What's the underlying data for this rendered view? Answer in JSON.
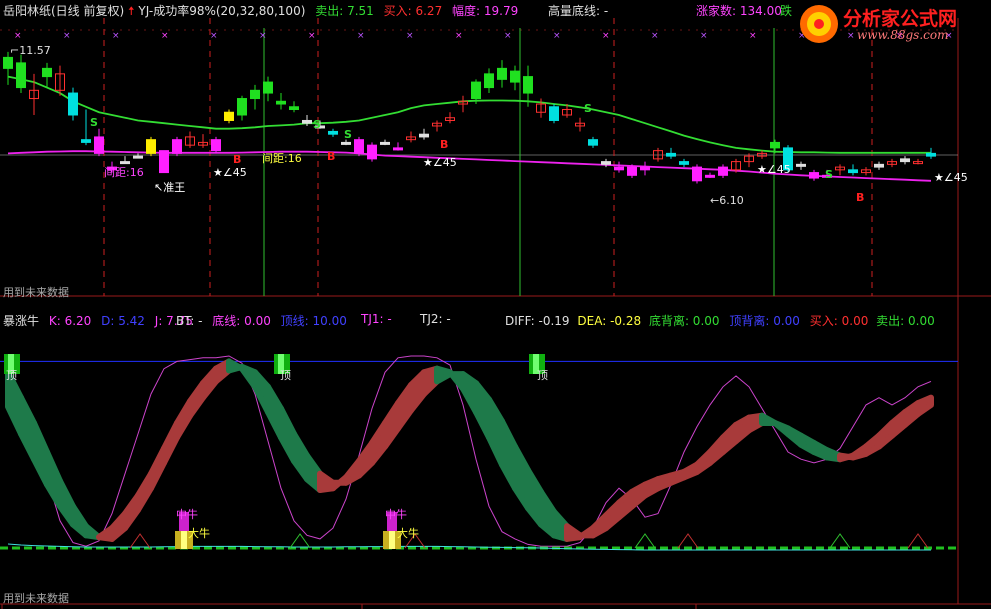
{
  "header_top": {
    "stock_name": "岳阳林纸(日线 前复权)",
    "indicator": "YJ-成功率98%(20,32,80,100)",
    "sell_label": "卖出: 7.51",
    "buy_label": "买入: 6.27",
    "range_label": "幅度: 19.79",
    "volume_line": "高量底线: -",
    "home_label": "涨家数: 134.00",
    "trailing": "跌"
  },
  "logo": {
    "brand": "分析家公式网",
    "site": "www.88gs.com"
  },
  "header_bottom": {
    "name": "暴涨牛",
    "k": "K: 6.20",
    "d": "D: 5.42",
    "j": "J: 7.75",
    "bt": "BT: -",
    "bottom_line": "底线: 0.00",
    "top_line": "顶线: 10.00",
    "tj1": "TJ1: -",
    "tj2": "TJ2: -",
    "diff": "DIFF: -0.19",
    "dea": "DEA: -0.28",
    "bottom_div": "底背离: 0.00",
    "top_div": "顶背离: 0.00",
    "buy": "买入: 0.00",
    "sell": "卖出: 0.00"
  },
  "annotations": {
    "high_price": "11.57",
    "low_price": "6.10",
    "future_data_top": "用到未来数据",
    "future_data_bottom": "用到未来数据",
    "distance": "间距:16",
    "king": "准王",
    "angle": "∠45",
    "buy_mark": "B",
    "sell_mark": "S",
    "top_mark": "顶",
    "mid_bull": "中牛",
    "big_bull": "大牛"
  },
  "colors": {
    "up": "#ff3030",
    "down": "#00e0e0",
    "green_bar": "#20e020",
    "magenta_bar": "#ff20ff",
    "ma_green": "#33dd33",
    "ma_magenta": "#ee22ee",
    "kdj_k_up": "#a83a3a",
    "kdj_k_down": "#1e7a4a",
    "dline": "#cc44cc"
  },
  "chart_data": [
    {
      "type": "candlestick",
      "title": "岳阳林纸(日线 前复权)",
      "price_annotations": {
        "high": 11.57,
        "low": 6.1
      },
      "candles": [
        {
          "o": 10.9,
          "h": 11.5,
          "l": 10.3,
          "c": 11.3,
          "k": "g"
        },
        {
          "o": 10.2,
          "h": 11.4,
          "l": 10.0,
          "c": 11.1,
          "k": "g"
        },
        {
          "o": 9.8,
          "h": 10.7,
          "l": 9.2,
          "c": 10.1,
          "k": "r"
        },
        {
          "o": 10.6,
          "h": 11.1,
          "l": 10.2,
          "c": 10.9,
          "k": "g"
        },
        {
          "o": 10.7,
          "h": 11.0,
          "l": 9.9,
          "c": 10.1,
          "k": "r"
        },
        {
          "o": 10.0,
          "h": 10.2,
          "l": 9.0,
          "c": 9.2,
          "k": "c"
        },
        {
          "o": 8.3,
          "h": 9.4,
          "l": 8.1,
          "c": 8.2,
          "k": "c"
        },
        {
          "o": 8.4,
          "h": 8.7,
          "l": 7.7,
          "c": 7.8,
          "k": "m"
        },
        {
          "o": 7.3,
          "h": 7.5,
          "l": 7.1,
          "c": 7.2,
          "k": "m"
        },
        {
          "o": 7.5,
          "h": 7.7,
          "l": 7.5,
          "c": 7.5,
          "k": "w"
        },
        {
          "o": 7.7,
          "h": 7.8,
          "l": 7.7,
          "c": 7.7,
          "k": "w"
        },
        {
          "o": 8.3,
          "h": 8.4,
          "l": 7.7,
          "c": 7.8,
          "k": "y"
        },
        {
          "o": 7.9,
          "h": 7.9,
          "l": 7.1,
          "c": 7.1,
          "k": "m"
        },
        {
          "o": 8.3,
          "h": 8.4,
          "l": 7.7,
          "c": 7.8,
          "k": "m"
        },
        {
          "o": 8.1,
          "h": 8.6,
          "l": 8.0,
          "c": 8.4,
          "k": "r"
        },
        {
          "o": 8.1,
          "h": 8.5,
          "l": 8.0,
          "c": 8.2,
          "k": "r"
        },
        {
          "o": 8.3,
          "h": 8.4,
          "l": 7.8,
          "c": 7.9,
          "k": "m"
        },
        {
          "o": 9.0,
          "h": 9.4,
          "l": 8.9,
          "c": 9.3,
          "k": "y"
        },
        {
          "o": 9.2,
          "h": 9.9,
          "l": 9.0,
          "c": 9.8,
          "k": "g"
        },
        {
          "o": 9.8,
          "h": 10.3,
          "l": 9.4,
          "c": 10.1,
          "k": "g"
        },
        {
          "o": 10.0,
          "h": 10.6,
          "l": 9.7,
          "c": 10.4,
          "k": "g"
        },
        {
          "o": 9.6,
          "h": 10.0,
          "l": 9.4,
          "c": 9.7,
          "k": "g"
        },
        {
          "o": 9.4,
          "h": 9.7,
          "l": 9.3,
          "c": 9.5,
          "k": "g"
        },
        {
          "o": 8.9,
          "h": 9.2,
          "l": 8.8,
          "c": 9.0,
          "k": "w"
        },
        {
          "o": 8.8,
          "h": 9.0,
          "l": 8.7,
          "c": 8.8,
          "k": "w"
        },
        {
          "o": 8.6,
          "h": 8.7,
          "l": 8.4,
          "c": 8.5,
          "k": "c"
        },
        {
          "o": 8.2,
          "h": 8.3,
          "l": 8.1,
          "c": 8.2,
          "k": "w"
        },
        {
          "o": 8.3,
          "h": 8.4,
          "l": 7.7,
          "c": 7.8,
          "k": "m"
        },
        {
          "o": 8.1,
          "h": 8.2,
          "l": 7.5,
          "c": 7.6,
          "k": "m"
        },
        {
          "o": 8.2,
          "h": 8.3,
          "l": 8.1,
          "c": 8.2,
          "k": "w"
        },
        {
          "o": 8.0,
          "h": 8.2,
          "l": 7.9,
          "c": 8.0,
          "k": "m"
        },
        {
          "o": 8.4,
          "h": 8.6,
          "l": 8.2,
          "c": 8.3,
          "k": "r"
        },
        {
          "o": 8.5,
          "h": 8.7,
          "l": 8.3,
          "c": 8.4,
          "k": "w"
        },
        {
          "o": 8.8,
          "h": 9.0,
          "l": 8.6,
          "c": 8.9,
          "k": "r"
        },
        {
          "o": 9.0,
          "h": 9.3,
          "l": 8.9,
          "c": 9.1,
          "k": "r"
        },
        {
          "o": 9.6,
          "h": 9.9,
          "l": 9.3,
          "c": 9.7,
          "k": "r"
        },
        {
          "o": 9.8,
          "h": 10.5,
          "l": 9.6,
          "c": 10.4,
          "k": "g"
        },
        {
          "o": 10.2,
          "h": 10.9,
          "l": 10.0,
          "c": 10.7,
          "k": "g"
        },
        {
          "o": 10.5,
          "h": 11.2,
          "l": 10.2,
          "c": 10.9,
          "k": "g"
        },
        {
          "o": 10.4,
          "h": 11.0,
          "l": 10.1,
          "c": 10.8,
          "k": "g"
        },
        {
          "o": 10.0,
          "h": 11.0,
          "l": 9.5,
          "c": 10.6,
          "k": "g"
        },
        {
          "o": 9.6,
          "h": 9.8,
          "l": 9.1,
          "c": 9.3,
          "k": "r"
        },
        {
          "o": 9.5,
          "h": 9.6,
          "l": 8.9,
          "c": 9.0,
          "k": "c"
        },
        {
          "o": 9.4,
          "h": 9.6,
          "l": 9.1,
          "c": 9.2,
          "k": "r"
        },
        {
          "o": 8.8,
          "h": 9.1,
          "l": 8.6,
          "c": 8.9,
          "k": "r"
        },
        {
          "o": 8.3,
          "h": 8.4,
          "l": 8.0,
          "c": 8.1,
          "k": "c"
        },
        {
          "o": 7.5,
          "h": 7.6,
          "l": 7.3,
          "c": 7.4,
          "k": "w"
        },
        {
          "o": 7.3,
          "h": 7.5,
          "l": 7.1,
          "c": 7.2,
          "k": "m"
        },
        {
          "o": 7.3,
          "h": 7.4,
          "l": 6.9,
          "c": 7.0,
          "k": "m"
        },
        {
          "o": 7.2,
          "h": 7.5,
          "l": 7.0,
          "c": 7.3,
          "k": "m"
        },
        {
          "o": 7.6,
          "h": 8.0,
          "l": 7.5,
          "c": 7.9,
          "k": "r"
        },
        {
          "o": 7.8,
          "h": 8.0,
          "l": 7.6,
          "c": 7.7,
          "k": "c"
        },
        {
          "o": 7.4,
          "h": 7.6,
          "l": 7.3,
          "c": 7.5,
          "k": "c"
        },
        {
          "o": 7.3,
          "h": 7.4,
          "l": 6.7,
          "c": 6.8,
          "k": "m"
        },
        {
          "o": 7.0,
          "h": 7.1,
          "l": 6.9,
          "c": 7.0,
          "k": "m"
        },
        {
          "o": 7.3,
          "h": 7.4,
          "l": 6.9,
          "c": 7.0,
          "k": "m"
        },
        {
          "o": 7.2,
          "h": 7.6,
          "l": 7.1,
          "c": 7.5,
          "k": "r"
        },
        {
          "o": 7.5,
          "h": 7.8,
          "l": 7.3,
          "c": 7.7,
          "k": "r"
        },
        {
          "o": 7.7,
          "h": 7.9,
          "l": 7.6,
          "c": 7.8,
          "k": "r"
        },
        {
          "o": 8.0,
          "h": 8.3,
          "l": 7.8,
          "c": 8.2,
          "k": "g"
        },
        {
          "o": 8.0,
          "h": 8.1,
          "l": 7.1,
          "c": 7.2,
          "k": "c"
        },
        {
          "o": 7.4,
          "h": 7.5,
          "l": 7.2,
          "c": 7.4,
          "k": "w"
        },
        {
          "o": 7.1,
          "h": 7.2,
          "l": 6.8,
          "c": 6.9,
          "k": "m"
        },
        {
          "o": 7.0,
          "h": 7.2,
          "l": 6.9,
          "c": 7.0,
          "k": "m"
        },
        {
          "o": 7.2,
          "h": 7.4,
          "l": 7.0,
          "c": 7.3,
          "k": "r"
        },
        {
          "o": 7.2,
          "h": 7.4,
          "l": 7.0,
          "c": 7.1,
          "k": "c"
        },
        {
          "o": 7.1,
          "h": 7.3,
          "l": 7.0,
          "c": 7.2,
          "k": "r"
        },
        {
          "o": 7.3,
          "h": 7.5,
          "l": 7.2,
          "c": 7.4,
          "k": "w"
        },
        {
          "o": 7.4,
          "h": 7.6,
          "l": 7.3,
          "c": 7.5,
          "k": "r"
        },
        {
          "o": 7.6,
          "h": 7.7,
          "l": 7.4,
          "c": 7.5,
          "k": "w"
        },
        {
          "o": 7.5,
          "h": 7.6,
          "l": 7.4,
          "c": 7.5,
          "k": "r"
        },
        {
          "o": 7.8,
          "h": 8.0,
          "l": 7.6,
          "c": 7.7,
          "k": "c"
        }
      ],
      "ma_green": [
        10.6,
        10.5,
        10.4,
        10.2,
        10.0,
        9.7,
        9.5,
        9.3,
        9.2,
        9.1,
        9.0,
        8.95,
        8.9,
        8.85,
        8.8,
        8.75,
        8.7,
        8.7,
        8.72,
        8.75,
        8.8,
        8.82,
        8.85,
        8.9,
        8.9,
        8.92,
        8.95,
        9.0,
        9.1,
        9.2,
        9.3,
        9.45,
        9.55,
        9.6,
        9.65,
        9.7,
        9.72,
        9.73,
        9.73,
        9.72,
        9.7,
        9.66,
        9.6,
        9.55,
        9.48,
        9.4,
        9.3,
        9.2,
        9.05,
        8.9,
        8.75,
        8.6,
        8.45,
        8.32,
        8.2,
        8.1,
        8.0,
        7.95,
        7.9,
        7.86,
        7.85,
        7.84,
        7.84,
        7.83,
        7.82,
        7.82,
        7.82,
        7.82,
        7.82,
        7.82,
        7.82,
        7.82
      ],
      "ma_magenta": [
        7.8,
        7.82,
        7.84,
        7.86,
        7.87,
        7.88,
        7.88,
        7.87,
        7.86,
        7.85,
        7.84,
        7.83,
        7.82,
        7.82,
        7.82,
        7.82,
        7.82,
        7.82,
        7.83,
        7.84,
        7.85,
        7.86,
        7.86,
        7.86,
        7.85,
        7.84,
        7.83,
        7.8,
        7.76,
        7.72,
        7.7,
        7.68,
        7.66,
        7.64,
        7.62,
        7.6,
        7.58,
        7.56,
        7.54,
        7.52,
        7.5,
        7.48,
        7.46,
        7.44,
        7.42,
        7.4,
        7.38,
        7.36,
        7.34,
        7.32,
        7.3,
        7.28,
        7.26,
        7.24,
        7.22,
        7.2,
        7.17,
        7.14,
        7.1,
        7.06,
        7.03,
        7.0,
        6.98,
        6.96,
        6.94,
        6.92,
        6.9,
        6.88,
        6.86,
        6.84,
        6.82,
        6.8
      ]
    },
    {
      "type": "line",
      "title": "暴涨牛",
      "ylim": [
        -0.3,
        10.3
      ],
      "top_line": 10.0,
      "bottom_line": 0.0,
      "k": [
        7.5,
        6.0,
        4.6,
        3.2,
        2.0,
        1.0,
        0.4,
        0.3,
        0.8,
        1.6,
        2.6,
        3.8,
        5.2,
        6.6,
        7.8,
        8.8,
        9.6,
        10.0,
        9.6,
        8.6,
        7.2,
        5.8,
        4.5,
        3.5,
        2.9,
        3.0,
        3.6,
        4.5,
        5.5,
        6.6,
        7.7,
        8.7,
        9.4,
        9.6,
        9.4,
        8.5,
        7.2,
        5.8,
        4.3,
        3.0,
        1.9,
        1.0,
        0.4,
        0.2,
        0.3,
        0.8,
        1.5,
        2.2,
        2.8,
        3.2,
        3.5,
        3.7,
        3.9,
        4.3,
        5.0,
        5.8,
        6.5,
        6.9,
        7.0,
        6.6,
        6.0,
        5.4,
        5.0,
        4.7,
        4.6,
        4.8,
        5.3,
        5.9,
        6.6,
        7.2,
        7.7,
        8.0
      ],
      "d": [
        9.4,
        8.0,
        6.6,
        5.0,
        3.4,
        2.0,
        0.9,
        0.3,
        0.2,
        0.8,
        1.8,
        3.0,
        4.4,
        5.8,
        7.0,
        8.0,
        8.9,
        9.5,
        9.7,
        9.4,
        8.6,
        7.4,
        6.0,
        4.8,
        3.8,
        3.3,
        3.3,
        3.7,
        4.4,
        5.3,
        6.3,
        7.3,
        8.2,
        8.9,
        9.3,
        9.3,
        8.8,
        7.9,
        6.7,
        5.3,
        4.0,
        2.8,
        1.7,
        0.9,
        0.4,
        0.4,
        0.8,
        1.4,
        2.0,
        2.6,
        3.0,
        3.3,
        3.6,
        3.9,
        4.4,
        5.0,
        5.6,
        6.2,
        6.6,
        6.6,
        6.3,
        5.9,
        5.5,
        5.1,
        4.8,
        4.7,
        4.9,
        5.3,
        5.9,
        6.5,
        7.1,
        7.6
      ],
      "j": [
        8.7,
        8.2,
        6.2,
        3.6,
        1.2,
        0.0,
        -0.2,
        0.1,
        1.6,
        3.8,
        6.0,
        8.2,
        9.6,
        10.0,
        10.1,
        10.2,
        10.2,
        10.3,
        9.9,
        8.2,
        5.6,
        3.0,
        1.2,
        0.4,
        0.2,
        0.8,
        2.4,
        4.8,
        7.4,
        9.4,
        10.2,
        10.3,
        10.3,
        10.2,
        9.8,
        7.6,
        4.6,
        2.0,
        0.6,
        0.2,
        -0.1,
        -0.2,
        -0.2,
        -0.2,
        0.0,
        0.8,
        2.2,
        3.0,
        2.4,
        1.4,
        1.6,
        3.2,
        5.0,
        6.4,
        7.6,
        8.6,
        9.2,
        8.6,
        7.4,
        6.2,
        5.0,
        4.6,
        4.4,
        4.6,
        5.2,
        6.4,
        7.6,
        8.0,
        7.6,
        8.0,
        8.6,
        8.9
      ],
      "zero_line": [
        0.2,
        0.15,
        0.12,
        0.1,
        0.08,
        0.06,
        0.05,
        0.05,
        0.05,
        0.05,
        0.05,
        0.05,
        0.06,
        0.07,
        0.08,
        0.08,
        0.08,
        0.08,
        0.08,
        0.07,
        0.06,
        0.06,
        0.05,
        0.05,
        0.05,
        0.05,
        0.06,
        0.06,
        0.07,
        0.07,
        0.08,
        0.08,
        0.08,
        0.08,
        0.07,
        0.06,
        0.05,
        0.04,
        0.03,
        0.02,
        0.01,
        0.0,
        -0.02,
        -0.04,
        -0.05,
        -0.06,
        -0.07,
        -0.08,
        -0.09,
        -0.1,
        -0.1,
        -0.1,
        -0.1,
        -0.1,
        -0.1,
        -0.1,
        -0.1,
        -0.1,
        -0.1,
        -0.1,
        -0.1,
        -0.1,
        -0.1,
        -0.1,
        -0.1,
        -0.1,
        -0.1,
        -0.1,
        -0.1,
        -0.1,
        -0.1,
        -0.1
      ],
      "signals": {
        "top": [
          1,
          17,
          33
        ],
        "mid_bull": [
          11,
          24
        ],
        "big_bull": [
          11,
          24
        ]
      }
    }
  ]
}
